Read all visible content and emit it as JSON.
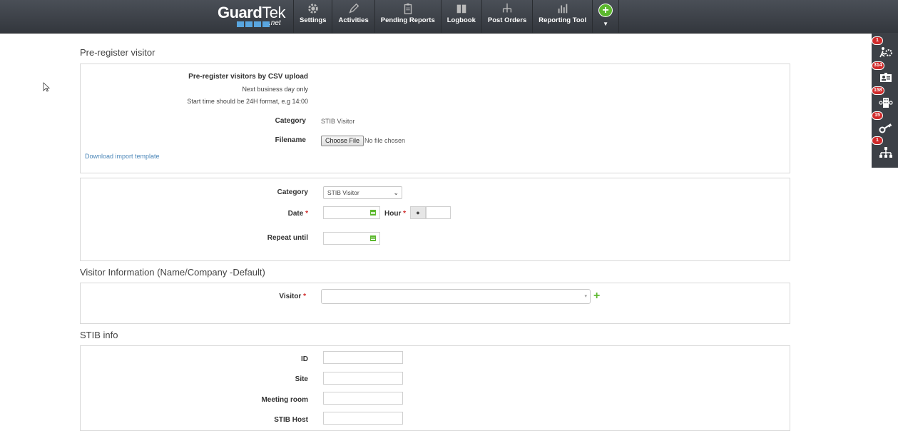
{
  "brand": {
    "name_bold": "Guard",
    "name_thin": "Tek",
    "suffix": ".net"
  },
  "nav": [
    {
      "label": "Settings",
      "icon": "gear-icon"
    },
    {
      "label": "Activities",
      "icon": "pencil-icon"
    },
    {
      "label": "Pending Reports",
      "icon": "clipboard-icon"
    },
    {
      "label": "Logbook",
      "icon": "book-icon"
    },
    {
      "label": "Post Orders",
      "icon": "org-chart-icon"
    },
    {
      "label": "Reporting Tool",
      "icon": "bar-chart-icon"
    }
  ],
  "rightbar": [
    {
      "badge": "1",
      "icon": "running-person-gear-icon"
    },
    {
      "badge": "314",
      "icon": "id-card-icon"
    },
    {
      "badge": "158",
      "icon": "building-gear-icon"
    },
    {
      "badge": "15",
      "icon": "key-icon"
    },
    {
      "badge": "1",
      "icon": "hierarchy-icon"
    }
  ],
  "preregister": {
    "title": "Pre-register visitor",
    "csv_heading": "Pre-register visitors by CSV upload",
    "note1": "Next business day only",
    "note2": "Start time should be 24H format, e.g 14:00",
    "category_label": "Category",
    "category_value": "STIB Visitor",
    "filename_label": "Filename",
    "file_button": "Choose File",
    "file_status": "No file chosen",
    "template_link": "Download import template"
  },
  "schedule": {
    "category_label": "Category",
    "category_selected": "STIB Visitor",
    "date_label": "Date",
    "hour_label": "Hour",
    "repeat_label": "Repeat until",
    "required_mark": "*",
    "date_value": "",
    "hour_value": "",
    "repeat_value": ""
  },
  "visitor_info": {
    "title": "Visitor Information (Name/Company -Default)",
    "visitor_label": "Visitor",
    "required_mark": "*",
    "visitor_value": ""
  },
  "stib_info": {
    "title": "STIB info",
    "fields": [
      {
        "label": "ID",
        "value": ""
      },
      {
        "label": "Site",
        "value": ""
      },
      {
        "label": "Meeting room",
        "value": ""
      },
      {
        "label": "STIB Host",
        "value": ""
      }
    ]
  },
  "colors": {
    "topbar": "#3d4148",
    "accent_green": "#5cb82e",
    "badge_red": "#d02a2a",
    "link": "#4a86b8"
  }
}
